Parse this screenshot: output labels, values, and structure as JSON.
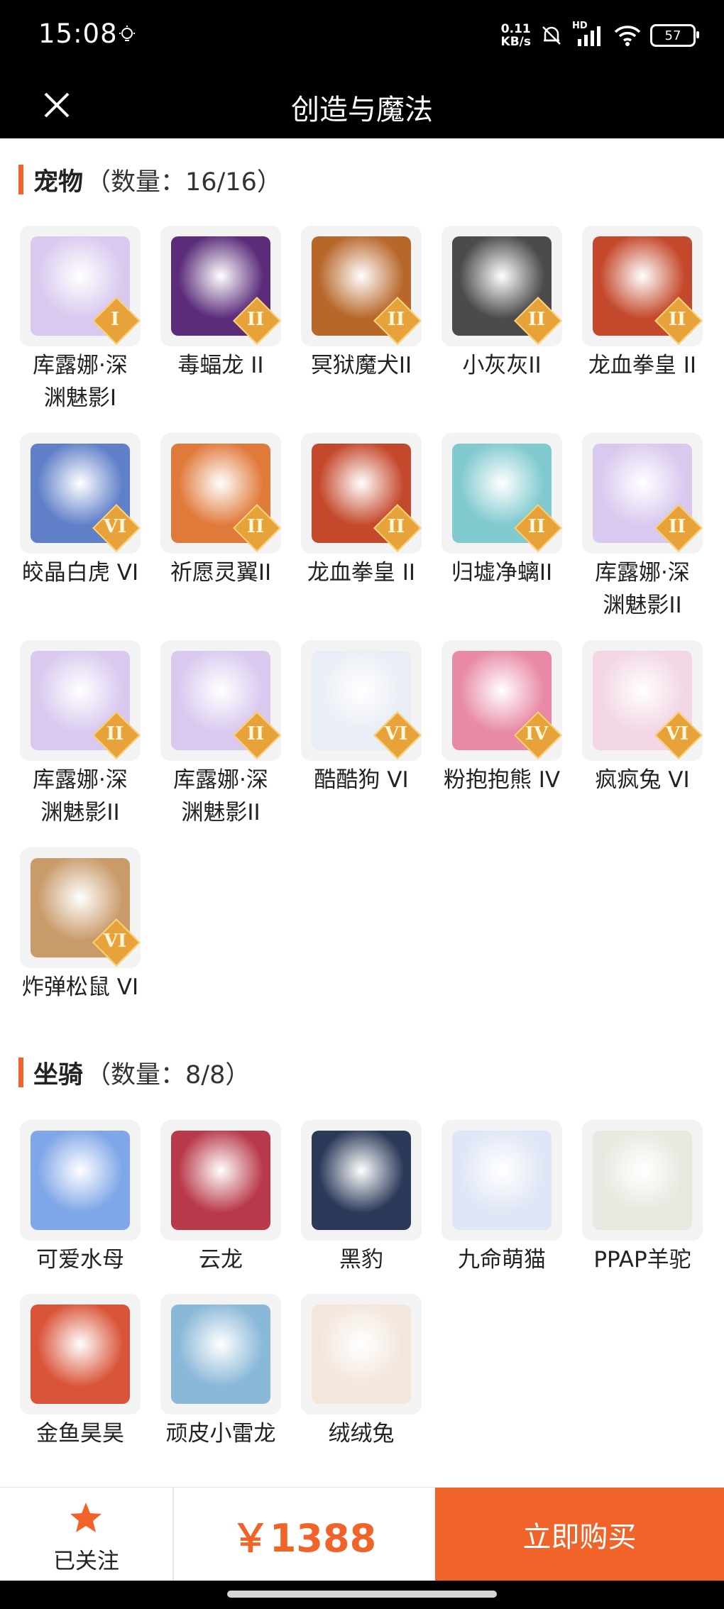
{
  "status_bar": {
    "time": "15:08",
    "net_speed_value": "0.11",
    "net_speed_unit": "KB/s",
    "network": "HD",
    "battery": "57"
  },
  "app_bar": {
    "title": "创造与魔法",
    "close_icon": "close-icon"
  },
  "pets": {
    "title": "宠物",
    "count": "（数量：16/16）",
    "items": [
      {
        "name": "库露娜·深\n渊魅影I",
        "level": "I",
        "color": "#d9c9ef"
      },
      {
        "name": "毒蝠龙 II",
        "level": "II",
        "color": "#5a2c7a"
      },
      {
        "name": "冥狱魔犬II",
        "level": "II",
        "color": "#b8672a"
      },
      {
        "name": "小灰灰II",
        "level": "II",
        "color": "#4b4b4b"
      },
      {
        "name": "龙血拳皇 II",
        "level": "II",
        "color": "#c4482b"
      },
      {
        "name": "皎晶白虎 VI",
        "level": "VI",
        "color": "#5f7fc8"
      },
      {
        "name": "祈愿灵翼II",
        "level": "II",
        "color": "#e07a3a"
      },
      {
        "name": "龙血拳皇 II",
        "level": "II",
        "color": "#c4482b"
      },
      {
        "name": "归墟净螭II",
        "level": "II",
        "color": "#7fc9cf"
      },
      {
        "name": "库露娜·深\n渊魅影II",
        "level": "II",
        "color": "#d9c9ef"
      },
      {
        "name": "库露娜·深\n渊魅影II",
        "level": "II",
        "color": "#d9c9ef"
      },
      {
        "name": "库露娜·深\n渊魅影II",
        "level": "II",
        "color": "#d9c9ef"
      },
      {
        "name": "酷酷狗 VI",
        "level": "VI",
        "color": "#e9edf5"
      },
      {
        "name": "粉抱抱熊 IV",
        "level": "IV",
        "color": "#e889a5"
      },
      {
        "name": "疯疯兔 VI",
        "level": "VI",
        "color": "#f2d6e4"
      },
      {
        "name": "炸弹松鼠 VI",
        "level": "VI",
        "color": "#c99b6b"
      }
    ]
  },
  "mounts": {
    "title": "坐骑",
    "count": "（数量：8/8）",
    "items": [
      {
        "name": "可爱水母",
        "color": "#7fa6e8"
      },
      {
        "name": "云龙",
        "color": "#b83a4a"
      },
      {
        "name": "黑豹",
        "color": "#2c3a5a"
      },
      {
        "name": "九命萌猫",
        "color": "#dfe6f5"
      },
      {
        "name": "PPAP羊驼",
        "color": "#e8e8e0"
      },
      {
        "name": "金鱼昊昊",
        "color": "#d9553a"
      },
      {
        "name": "顽皮小雷龙",
        "color": "#8ab8d8"
      },
      {
        "name": "绒绒兔",
        "color": "#f3e6dc"
      }
    ]
  },
  "bottom_bar": {
    "follow_label": "已关注",
    "price": "￥1388",
    "buy_label": "立即购买"
  },
  "colors": {
    "accent": "#f0642a",
    "badge": "#e8a23a"
  }
}
